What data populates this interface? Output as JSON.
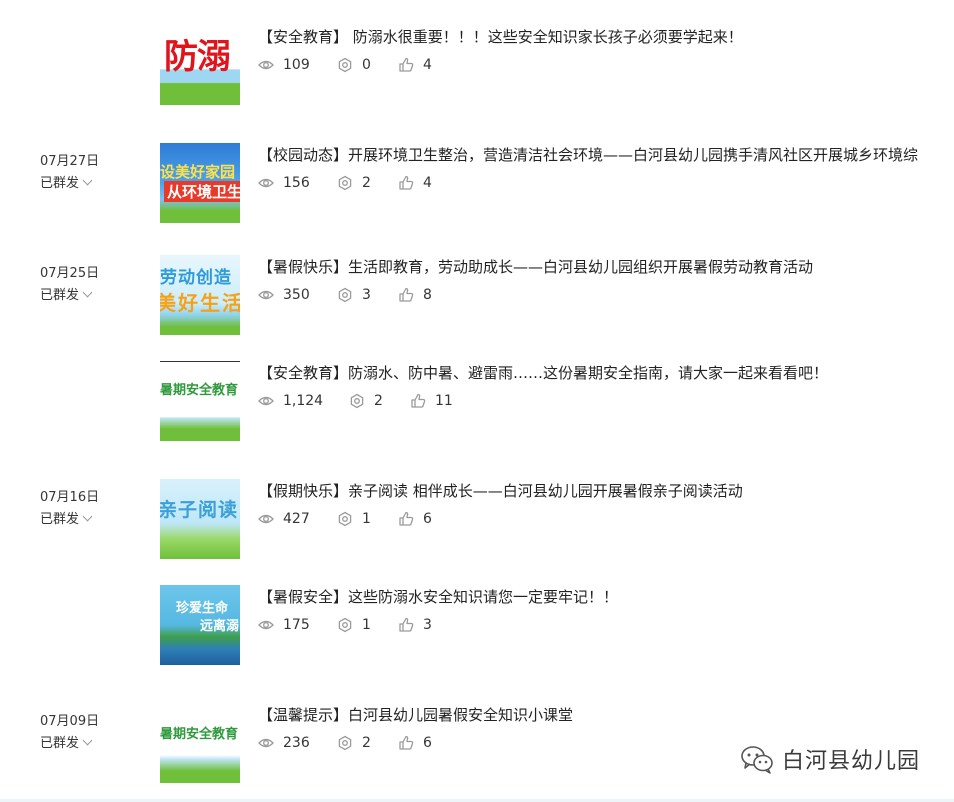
{
  "articles": [
    {
      "date": "",
      "status": "",
      "title": "【安全教育】 防溺水很重要！！！这些安全知识家长孩子必须要学起来！",
      "views": "109",
      "shares": "0",
      "likes": "4",
      "thumb_text": "防溺"
    },
    {
      "date": "07月27日",
      "status": "已群发",
      "title": "【校园动态】开展环境卫生整治，营造清洁社会环境——白河县幼儿园携手清风社区开展城乡环境综",
      "views": "156",
      "shares": "2",
      "likes": "4",
      "thumb_text": "设美好家园",
      "thumb_text2": "从环境卫生做"
    },
    {
      "date": "07月25日",
      "status": "已群发",
      "title": "【暑假快乐】生活即教育，劳动助成长——白河县幼儿园组织开展暑假劳动教育活动",
      "views": "350",
      "shares": "3",
      "likes": "8",
      "thumb_text": "劳动创造",
      "thumb_text2": "美好生活"
    },
    {
      "date": "",
      "status": "",
      "title": "【安全教育】防溺水、防中暑、避雷雨……这份暑期安全指南，请大家一起来看看吧！",
      "views": "1,124",
      "shares": "2",
      "likes": "11",
      "thumb_text": "暑期安全教育"
    },
    {
      "date": "07月16日",
      "status": "已群发",
      "title": "【假期快乐】亲子阅读 相伴成长——白河县幼儿园开展暑假亲子阅读活动",
      "views": "427",
      "shares": "1",
      "likes": "6",
      "thumb_text": "亲子阅读"
    },
    {
      "date": "",
      "status": "",
      "title": "【暑假安全】这些防溺水安全知识请您一定要牢记！！",
      "views": "175",
      "shares": "1",
      "likes": "3",
      "thumb_text": "珍爱生命",
      "thumb_text2": "远离溺"
    },
    {
      "date": "07月09日",
      "status": "已群发",
      "title": "【温馨提示】白河县幼儿园暑假安全知识小课堂",
      "views": "236",
      "shares": "2",
      "likes": "6",
      "thumb_text": "暑期安全教育"
    }
  ],
  "brand": {
    "name": "白河县幼儿园"
  },
  "icons": {
    "views": "eye-icon",
    "shares": "share-icon",
    "likes": "thumbs-up-icon"
  },
  "colors": {
    "text": "#353535",
    "icon": "#9a9a9a"
  }
}
